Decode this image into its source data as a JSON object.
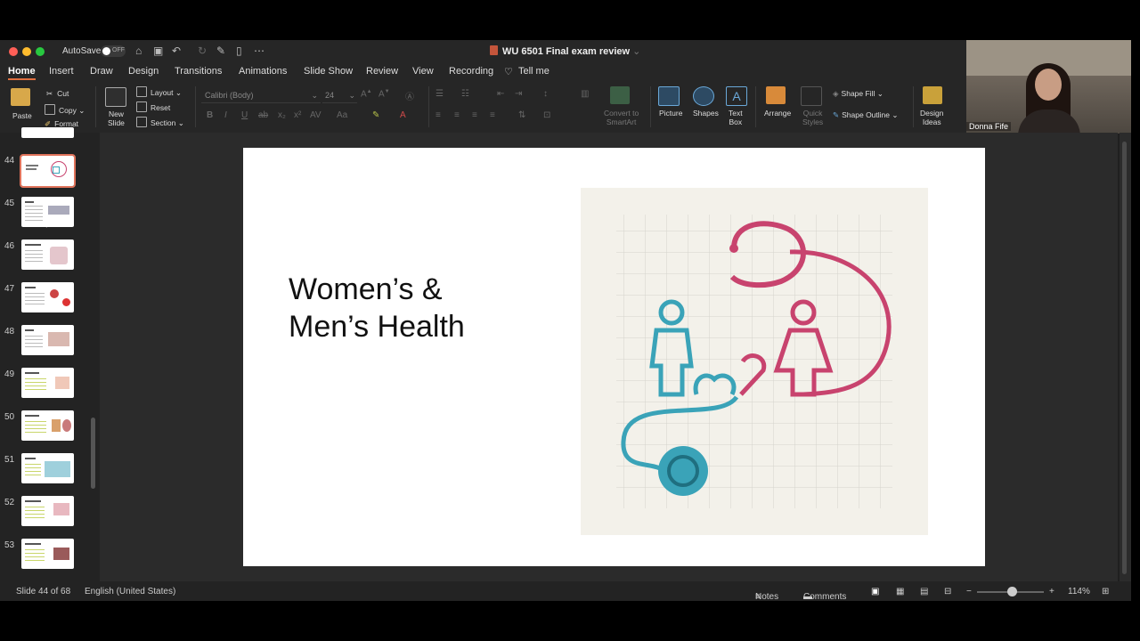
{
  "window": {
    "autosave_label": "AutoSave",
    "autosave_state": "OFF",
    "document_title": "WU 6501 Final exam review"
  },
  "menu": {
    "tabs": [
      "Home",
      "Insert",
      "Draw",
      "Design",
      "Transitions",
      "Animations",
      "Slide Show",
      "Review",
      "View",
      "Recording"
    ],
    "tell_me": "Tell me"
  },
  "ribbon": {
    "paste": "Paste",
    "cut": "Cut",
    "copy": "Copy",
    "format": "Format",
    "new_slide_1": "New",
    "new_slide_2": "Slide",
    "layout": "Layout",
    "reset": "Reset",
    "section": "Section",
    "font_name": "Calibri (Body)",
    "font_size": "24",
    "convert_smartart_1": "Convert to",
    "convert_smartart_2": "SmartArt",
    "picture": "Picture",
    "shapes": "Shapes",
    "text_box_1": "Text",
    "text_box_2": "Box",
    "arrange": "Arrange",
    "quick_styles_1": "Quick",
    "quick_styles_2": "Styles",
    "shape_fill": "Shape Fill",
    "shape_outline": "Shape Outline",
    "design_ideas_1": "Design",
    "design_ideas_2": "Ideas"
  },
  "webcam": {
    "name": "Donna Fife"
  },
  "thumbnails": [
    {
      "num": "44",
      "selected": true
    },
    {
      "num": "45"
    },
    {
      "num": "46"
    },
    {
      "num": "47"
    },
    {
      "num": "48"
    },
    {
      "num": "49"
    },
    {
      "num": "50"
    },
    {
      "num": "51"
    },
    {
      "num": "52"
    },
    {
      "num": "53"
    }
  ],
  "slide": {
    "title_line1": "Women’s &",
    "title_line2": "Men’s Health"
  },
  "status": {
    "slide_info": "Slide 44 of 68",
    "language": "English (United States)",
    "notes": "Notes",
    "comments": "Comments",
    "zoom": "114%"
  },
  "colors": {
    "accent": "#e0735b",
    "illustration_teal": "#3aa3b8",
    "illustration_pink": "#c8436e"
  }
}
